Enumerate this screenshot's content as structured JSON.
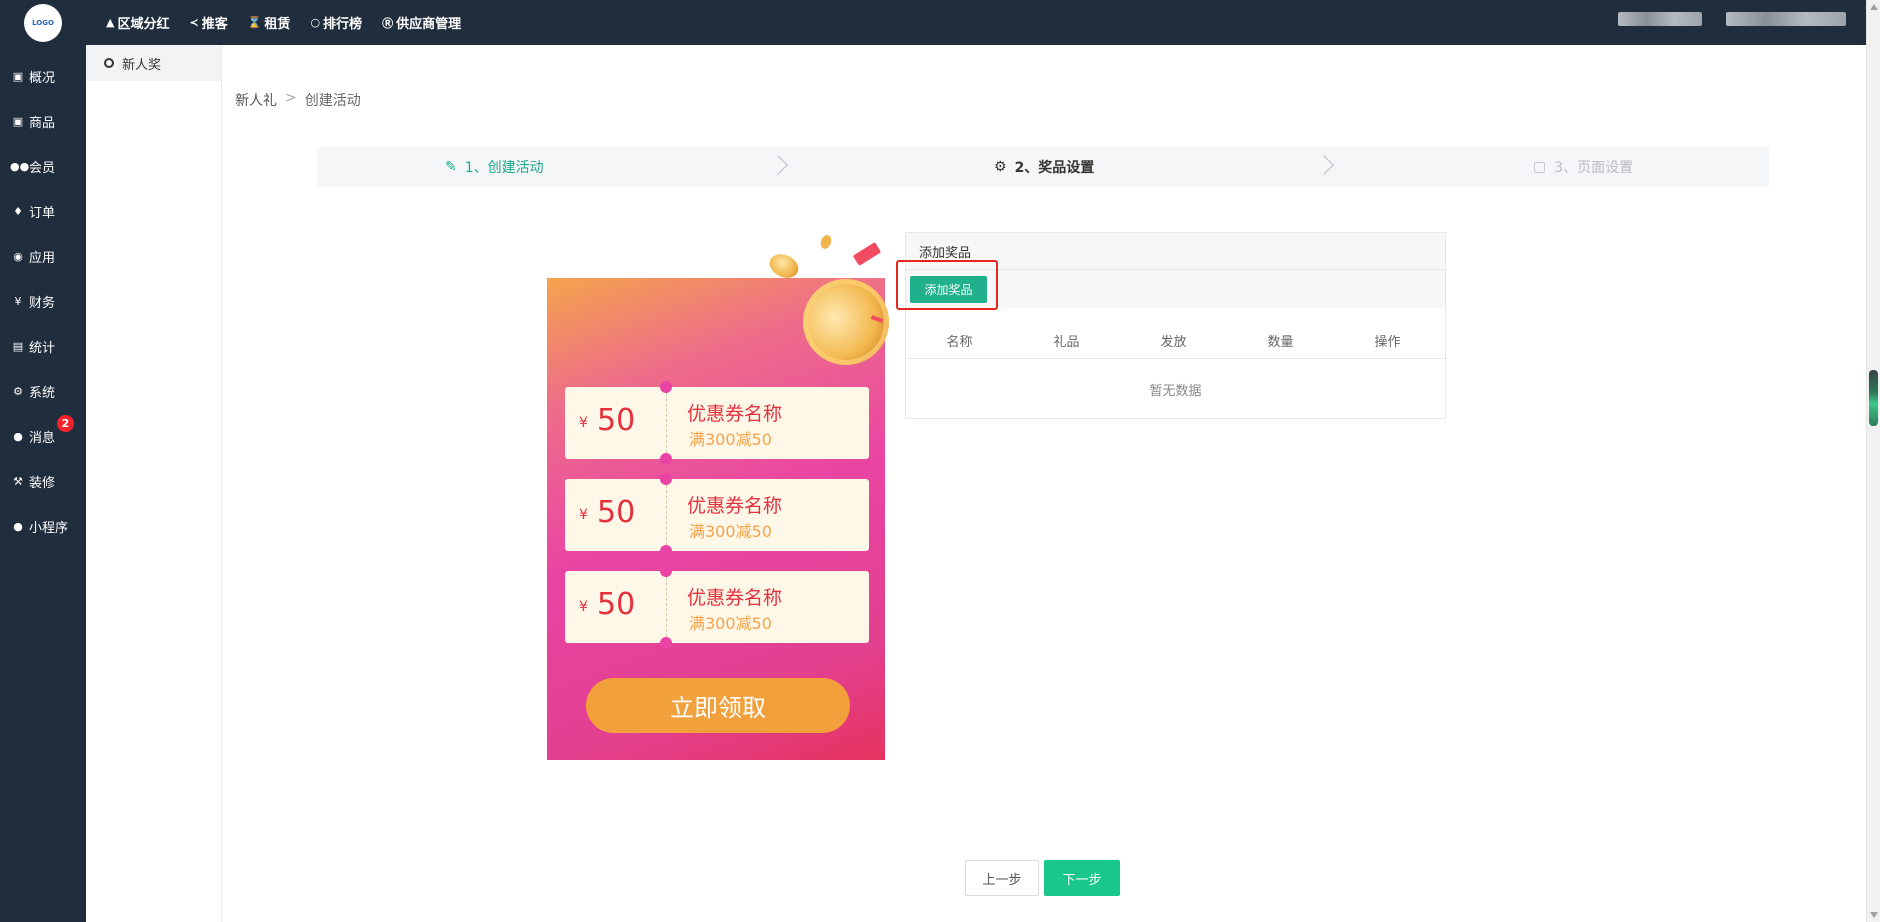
{
  "logo": {
    "text": "LOGO"
  },
  "top_nav": [
    {
      "icon": "shirt-icon",
      "label": "区域分红"
    },
    {
      "icon": "share-icon",
      "label": "推客"
    },
    {
      "icon": "hourglass-icon",
      "label": "租赁"
    },
    {
      "icon": "circle-icon",
      "label": "排行榜"
    },
    {
      "icon": "skype-icon",
      "label": "供应商管理"
    }
  ],
  "sidebar": [
    {
      "icon": "dashboard-icon",
      "label": "概况"
    },
    {
      "icon": "goods-icon",
      "label": "商品"
    },
    {
      "icon": "users-icon",
      "label": "会员"
    },
    {
      "icon": "cart-icon",
      "label": "订单"
    },
    {
      "icon": "cubes-icon",
      "label": "应用"
    },
    {
      "icon": "yen-icon",
      "label": "财务"
    },
    {
      "icon": "bar-chart-icon",
      "label": "统计"
    },
    {
      "icon": "gears-icon",
      "label": "系统"
    },
    {
      "icon": "comment-icon",
      "label": "消息",
      "badge": "2"
    },
    {
      "icon": "gavel-icon",
      "label": "装修"
    },
    {
      "icon": "wechat-icon",
      "label": "小程序"
    }
  ],
  "sub_nav": {
    "label": "新人奖"
  },
  "breadcrumb": {
    "parent": "新人礼",
    "separator": ">",
    "current": "创建活动"
  },
  "steps": [
    {
      "icon": "pencil-icon",
      "label": "1、创建活动",
      "state": "done"
    },
    {
      "icon": "gear-icon",
      "label": "2、奖品设置",
      "state": "active"
    },
    {
      "icon": "bag-icon",
      "label": "3、页面设置",
      "state": "pending"
    }
  ],
  "poster": {
    "coupons": [
      {
        "currency": "¥",
        "amount": "50",
        "name": "优惠券名称",
        "desc": "满300减50"
      },
      {
        "currency": "¥",
        "amount": "50",
        "name": "优惠券名称",
        "desc": "满300减50"
      },
      {
        "currency": "¥",
        "amount": "50",
        "name": "优惠券名称",
        "desc": "满300减50"
      }
    ],
    "claim_button": "立即领取"
  },
  "prize_panel": {
    "title": "添加奖品",
    "add_button": "添加奖品",
    "columns": [
      "名称",
      "礼品",
      "发放",
      "数量",
      "操作"
    ],
    "empty_text": "暂无数据"
  },
  "footer": {
    "prev": "上一步",
    "next": "下一步"
  },
  "colors": {
    "sidebar_bg": "#1f2d3d",
    "accent_green": "#1aa98c",
    "next_button": "#19c78b",
    "highlight_red": "#e5281e",
    "coupon_red": "#e5313e",
    "claim_orange": "#f2a03c"
  }
}
